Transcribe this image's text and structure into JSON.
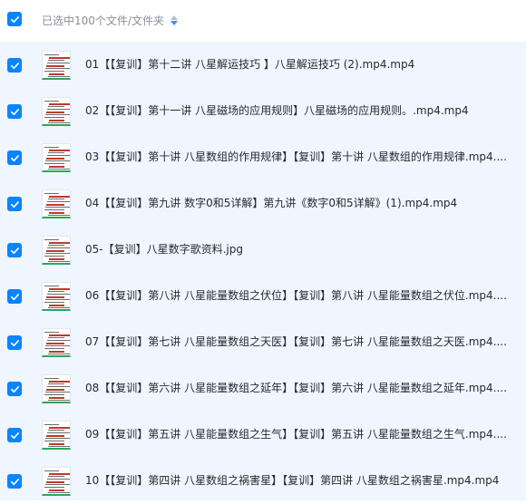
{
  "header": {
    "selection_label": "已选中100个文件/文件夹"
  },
  "colors": {
    "accent": "#0a84ff",
    "selected_row_bg": "#f0f6ff"
  },
  "files": [
    {
      "name": "01【【复训】第十二讲 八星解运技巧 】八星解运技巧 (2).mp4.mp4",
      "checked": true
    },
    {
      "name": "02【【复训】第十一讲 八星磁场的应用规则】八星磁场的应用规则。.mp4.mp4",
      "checked": true
    },
    {
      "name": "03【【复训】第十讲 八星数组的作用规律】【复训】第十讲 八星数组的作用规律.mp4....",
      "checked": true
    },
    {
      "name": "04【【复训】第九讲 数字0和5详解】第九讲《数字0和5详解》(1).mp4.mp4",
      "checked": true
    },
    {
      "name": "05-【复训】八星数字歌资料.jpg",
      "checked": true
    },
    {
      "name": "06【【复训】第八讲 八星能量数组之伏位】【复训】第八讲 八星能量数组之伏位.mp4....",
      "checked": true
    },
    {
      "name": "07【【复训】第七讲 八星能量数组之天医】【复训】第七讲 八星能量数组之天医.mp4....",
      "checked": true
    },
    {
      "name": "08【【复训】第六讲 八星能量数组之延年】【复训】第六讲 八星能量数组之延年.mp4....",
      "checked": true
    },
    {
      "name": "09【【复训】第五讲 八星能量数组之生气】【复训】第五讲 八星能量数组之生气.mp4....",
      "checked": true
    },
    {
      "name": "10【【复训】第四讲 八星数组之祸害星】【复训】第四讲 八星数组之祸害星.mp4.mp4",
      "checked": true
    }
  ]
}
